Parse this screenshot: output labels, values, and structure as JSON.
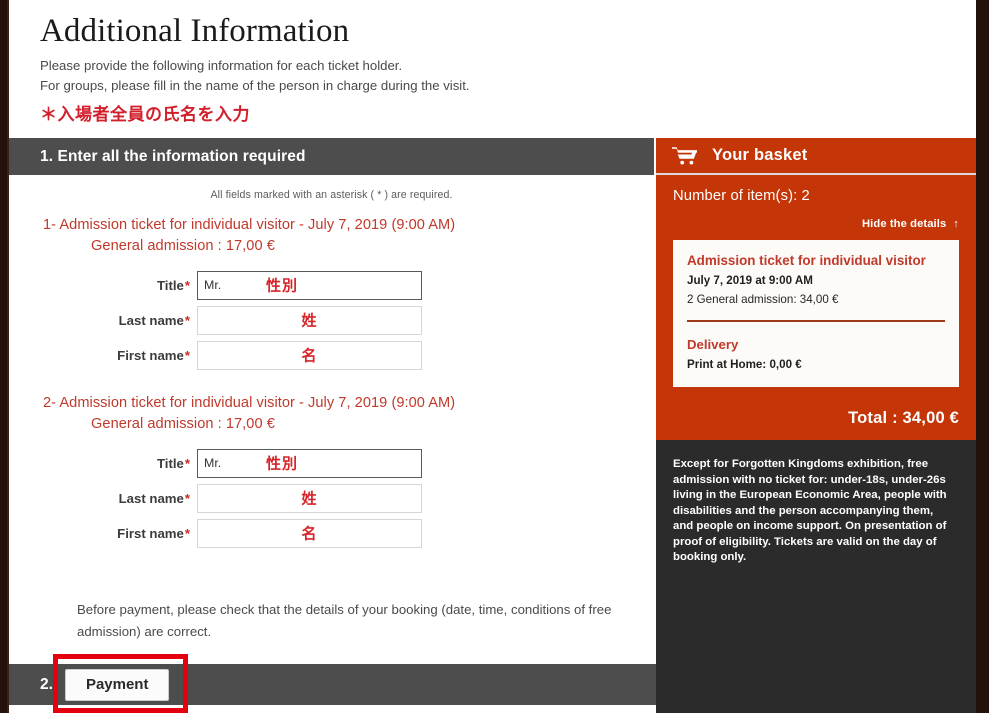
{
  "page": {
    "title": "Additional Information",
    "intro_line_1": "Please provide the following information for each ticket holder.",
    "intro_line_2": "For groups, please fill in the name of the person in charge during the visit.",
    "jp_note": "＊入場者全員の氏名を入力"
  },
  "step1": {
    "heading": "1. Enter all the information required",
    "required_note": "All fields marked with an asterisk ( * ) are required.",
    "tickets": [
      {
        "index": "1-",
        "title": "Admission ticket for individual visitor - July 7, 2019 (9:00 AM)",
        "subtitle": "General admission :  17,00 €",
        "fields": {
          "title_label": "Title",
          "title_value": "Mr.",
          "title_jp": "性別",
          "lastname_label": "Last name",
          "lastname_value": "",
          "lastname_jp": "姓",
          "firstname_label": "First name",
          "firstname_value": "",
          "firstname_jp": "名"
        }
      },
      {
        "index": "2-",
        "title": "Admission ticket for individual visitor - July 7, 2019 (9:00 AM)",
        "subtitle": "General admission :  17,00 €",
        "fields": {
          "title_label": "Title",
          "title_value": "Mr.",
          "title_jp": "性別",
          "lastname_label": "Last name",
          "lastname_value": "",
          "lastname_jp": "姓",
          "firstname_label": "First name",
          "firstname_value": "",
          "firstname_jp": "名"
        }
      }
    ],
    "required_star": "*",
    "before_payment": "Before payment, please check that the details of your booking (date, time, conditions of free admission) are correct."
  },
  "step2": {
    "number": "2.",
    "payment_label": "Payment"
  },
  "basket": {
    "header_title": "Your basket",
    "cart_icon": "shopping-cart-icon",
    "item_count": "Number of item(s): 2",
    "hide_details": "Hide the details",
    "hide_details_arrow": "↑",
    "detail": {
      "item_title": "Admission ticket for individual visitor",
      "item_datetime": "July 7, 2019 at 9:00 AM",
      "item_qty_price": "2 General admission: 34,00 €",
      "delivery_title": "Delivery",
      "delivery_value": "Print at Home: 0,00 €"
    },
    "total": "Total : 34,00 €",
    "footer_note": "Except for Forgotten Kingdoms exhibition, free admission with no ticket for: under-18s, under-26s living in the European Economic Area, people with disabilities and the person accompanying them, and people on income support. On presentation of proof of eligibility. Tickets are valid on the day of booking only."
  },
  "colors": {
    "brand_red": "#c43507",
    "dark_bar": "#4d4d4d",
    "panel_dark": "#2b2b2b",
    "annotation_red": "#e3000f",
    "link_red": "#c0392b",
    "jp_red": "#d6242a"
  }
}
